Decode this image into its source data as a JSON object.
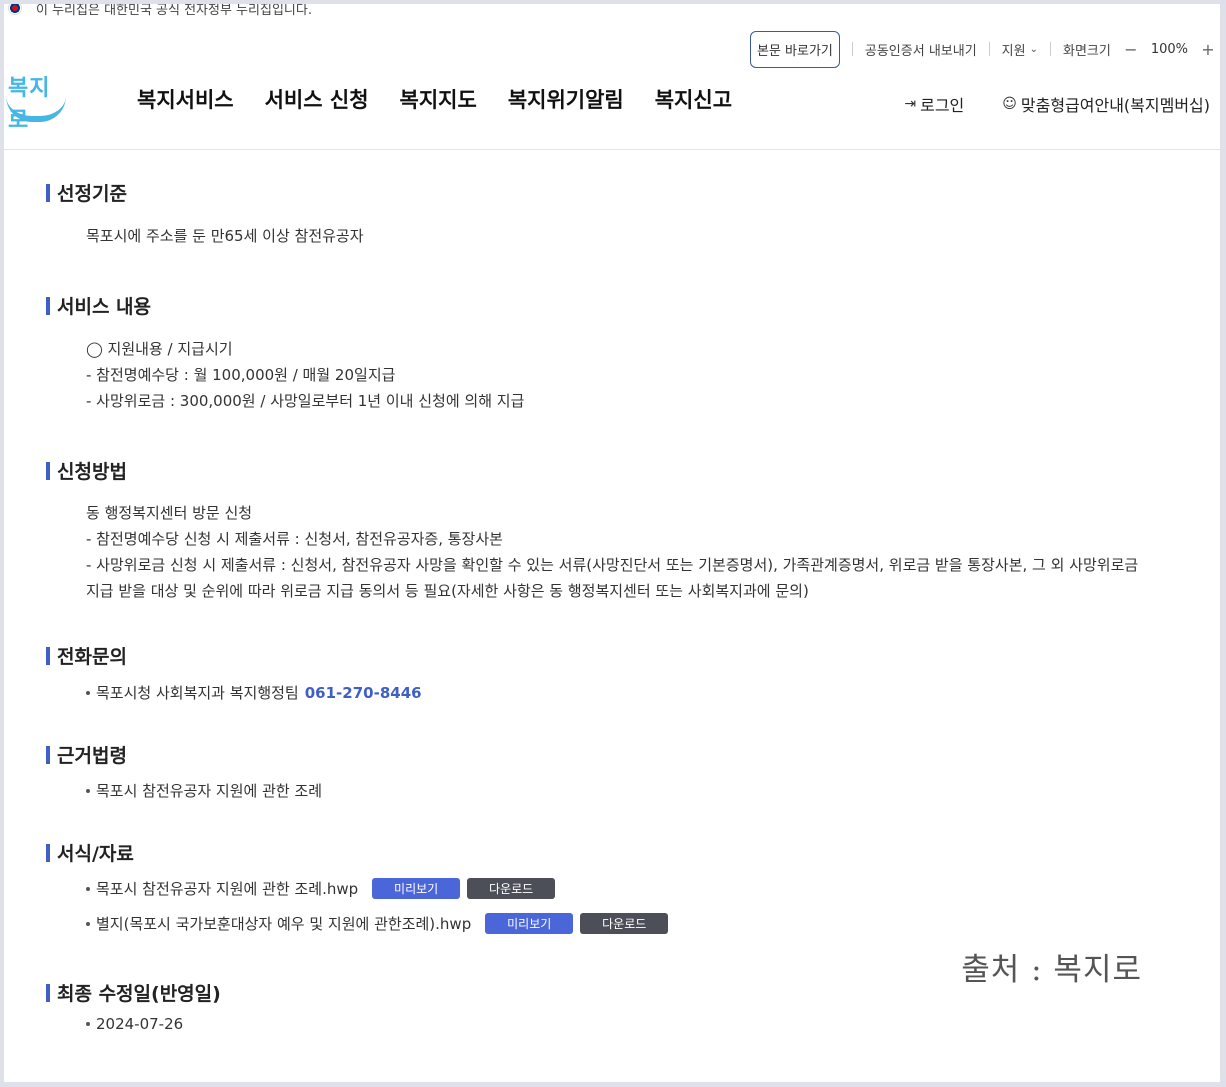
{
  "gov_banner": "이 누리집은 대한민국 공식 전자정부 누리집입니다.",
  "util": {
    "skip": "본문 바로가기",
    "cert": "공동인증서 내보내기",
    "support": "지원",
    "zoom_label": "화면크기",
    "zoom_minus": "−",
    "zoom_value": "100%",
    "zoom_plus": "+"
  },
  "logo": "복지로",
  "gnb": [
    "복지서비스",
    "서비스 신청",
    "복지지도",
    "복지위기알림",
    "복지신고"
  ],
  "header_right": {
    "login": "로그인",
    "membership": "맞춤형급여안내(복지멤버십)"
  },
  "sections": {
    "criteria": {
      "title": "선정기준",
      "text": "목포시에 주소를 둔 만65세 이상 참전유공자"
    },
    "service": {
      "title": "서비스 내용",
      "lines": [
        "◯ 지원내용 / 지급시기",
        "- 참전명예수당 : 월 100,000원 / 매월 20일지급",
        "- 사망위로금 : 300,000원 / 사망일로부터 1년 이내 신청에 의해 지급"
      ]
    },
    "apply": {
      "title": "신청방법",
      "lines": [
        "동 행정복지센터 방문 신청",
        "- 참전명예수당 신청 시 제출서류 : 신청서, 참전유공자증, 통장사본",
        "- 사망위로금 신청 시 제출서류 : 신청서, 참전유공자 사망을 확인할 수 있는 서류(사망진단서 또는 기본증명서), 가족관계증명서, 위로금 받을 통장사본, 그 외 사망위로금 지급 받을 대상 및 순위에 따라 위로금 지급 동의서 등 필요(자세한 사항은 동 행정복지센터 또는 사회복지과에 문의)"
      ]
    },
    "phone": {
      "title": "전화문의",
      "org": "목포시청 사회복지과 복지행정팀",
      "number": "061-270-8446"
    },
    "law": {
      "title": "근거법령",
      "item": "목포시 참전유공자 지원에 관한 조례"
    },
    "forms": {
      "title": "서식/자료",
      "files": [
        {
          "name": "목포시 참전유공자 지원에 관한 조례.hwp",
          "preview": "미리보기",
          "download": "다운로드"
        },
        {
          "name": "별지(목포시 국가보훈대상자 예우 및 지원에 관한조례).hwp",
          "preview": "미리보기",
          "download": "다운로드"
        }
      ]
    },
    "updated": {
      "title": "최종 수정일(반영일)",
      "date": "2024-07-26"
    }
  },
  "watermark": "출처 : 복지로",
  "colors": {
    "accent": "#3f5fc4",
    "preview_btn": "#4a66d8",
    "download_btn": "#4c4f58",
    "logo": "#46b6e6"
  }
}
